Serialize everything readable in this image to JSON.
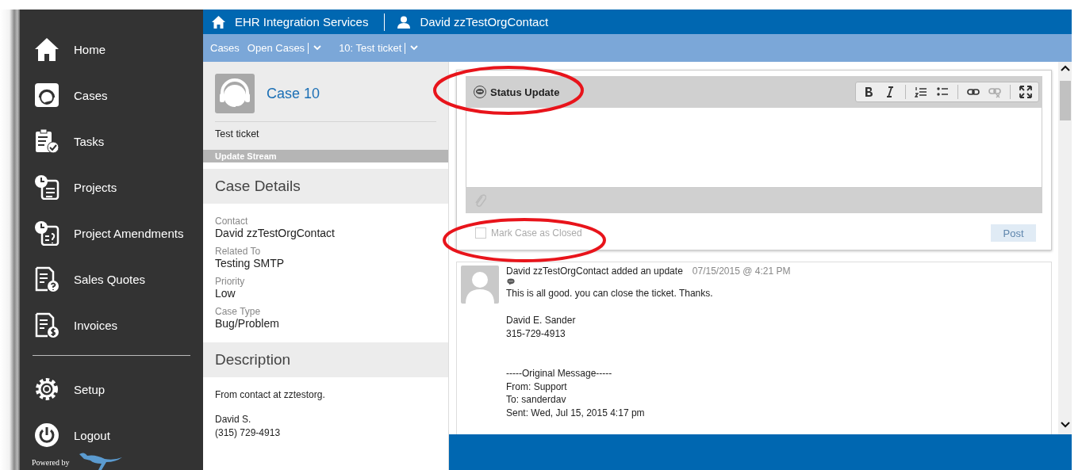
{
  "sidebar": {
    "items": [
      {
        "label": "Home"
      },
      {
        "label": "Cases"
      },
      {
        "label": "Tasks"
      },
      {
        "label": "Projects"
      },
      {
        "label": "Project Amendments"
      },
      {
        "label": "Sales Quotes"
      },
      {
        "label": "Invoices"
      }
    ],
    "bottom_items": [
      {
        "label": "Setup"
      },
      {
        "label": "Logout"
      }
    ],
    "powered_by": "Powered by"
  },
  "top_bar": {
    "organization": "EHR Integration Services",
    "user": "David zzTestOrgContact"
  },
  "breadcrumbs": [
    {
      "label": "Cases",
      "dropdown": false
    },
    {
      "label": "Open Cases",
      "dropdown": true
    },
    {
      "label": "10: Test ticket",
      "dropdown": true
    }
  ],
  "case": {
    "title": "Case 10",
    "subject": "Test ticket",
    "stream_label": "Update Stream",
    "details_heading": "Case Details",
    "details": [
      {
        "label": "Contact",
        "value": "David zzTestOrgContact"
      },
      {
        "label": "Related To",
        "value": "Testing SMTP"
      },
      {
        "label": "Priority",
        "value": "Low"
      },
      {
        "label": "Case Type",
        "value": "Bug/Problem"
      }
    ],
    "description_heading": "Description",
    "description": [
      "From contact at zztestorg.",
      "David S.\n(315) 729-4913"
    ]
  },
  "editor": {
    "title": "Status Update",
    "mark_closed": {
      "label": "Mark Case as Closed",
      "checked": false
    },
    "post_button": {
      "label": "Post",
      "disabled": true
    }
  },
  "updates": [
    {
      "author_line": "David zzTestOrgContact added an update",
      "time": "07/15/2015 @ 4:21 PM",
      "body": [
        "This is all good. you can close the ticket. Thanks.",
        "David E. Sander\n315-729-4913",
        "-----Original Message-----\nFrom: Support\nTo: sanderdav\nSent: Wed, Jul 15, 2015 4:17 pm"
      ]
    }
  ]
}
